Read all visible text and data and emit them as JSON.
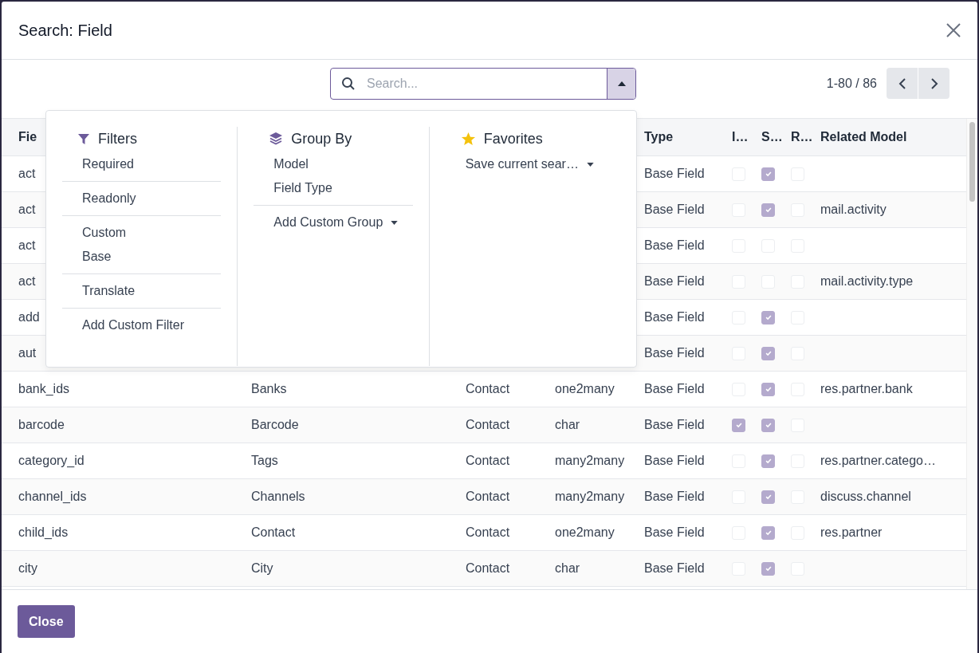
{
  "dialog": {
    "title": "Search: Field"
  },
  "search": {
    "placeholder": "Search...",
    "panel_open": true
  },
  "pager": {
    "range": "1-80 / 86"
  },
  "search_panel": {
    "filters": {
      "title": "Filters",
      "groups": [
        [
          {
            "label": "Required"
          }
        ],
        [
          {
            "label": "Readonly"
          }
        ],
        [
          {
            "label": "Custom"
          },
          {
            "label": "Base"
          }
        ],
        [
          {
            "label": "Translate"
          }
        ],
        [
          {
            "label": "Add Custom Filter"
          }
        ]
      ]
    },
    "group_by": {
      "title": "Group By",
      "groups": [
        [
          {
            "label": "Model"
          },
          {
            "label": "Field Type"
          }
        ],
        [
          {
            "label": "Add Custom Group",
            "has_caret": true
          }
        ]
      ]
    },
    "favorites": {
      "title": "Favorites",
      "groups": [
        [
          {
            "label": "Save current sear…",
            "has_caret": true
          }
        ]
      ]
    }
  },
  "table": {
    "columns": [
      {
        "label": "Fie"
      },
      {},
      {},
      {},
      {
        "label": "Type"
      },
      {
        "label": "I…"
      },
      {
        "label": "S…"
      },
      {
        "label": "R…"
      },
      {
        "label": "Related Model"
      }
    ],
    "rows": [
      {
        "field": "act",
        "type": "Base Field",
        "col_i": false,
        "col_s": true,
        "col_r": false
      },
      {
        "field": "act",
        "type": "Base Field",
        "col_i": false,
        "col_s": true,
        "col_r": false,
        "related": "mail.activity"
      },
      {
        "field": "act",
        "type": "Base Field",
        "col_i": false,
        "col_s": false,
        "col_r": false
      },
      {
        "field": "act",
        "type": "Base Field",
        "col_i": false,
        "col_s": false,
        "col_r": false,
        "related": "mail.activity.type"
      },
      {
        "field": "add",
        "type": "Base Field",
        "col_i": false,
        "col_s": true,
        "col_r": false
      },
      {
        "field": "aut",
        "type": "Base Field",
        "col_i": false,
        "col_s": true,
        "col_r": false
      },
      {
        "field": "bank_ids",
        "label": "Banks",
        "model": "Contact",
        "ftype": "one2many",
        "type": "Base Field",
        "col_i": false,
        "col_s": true,
        "col_r": false,
        "related": "res.partner.bank"
      },
      {
        "field": "barcode",
        "label": "Barcode",
        "model": "Contact",
        "ftype": "char",
        "type": "Base Field",
        "col_i": true,
        "col_s": true,
        "col_r": false
      },
      {
        "field": "category_id",
        "label": "Tags",
        "model": "Contact",
        "ftype": "many2many",
        "type": "Base Field",
        "col_i": false,
        "col_s": true,
        "col_r": false,
        "related": "res.partner.catego…"
      },
      {
        "field": "channel_ids",
        "label": "Channels",
        "model": "Contact",
        "ftype": "many2many",
        "type": "Base Field",
        "col_i": false,
        "col_s": true,
        "col_r": false,
        "related": "discuss.channel"
      },
      {
        "field": "child_ids",
        "label": "Contact",
        "model": "Contact",
        "ftype": "one2many",
        "type": "Base Field",
        "col_i": false,
        "col_s": true,
        "col_r": false,
        "related": "res.partner"
      },
      {
        "field": "city",
        "label": "City",
        "model": "Contact",
        "ftype": "char",
        "type": "Base Field",
        "col_i": false,
        "col_s": true,
        "col_r": false
      }
    ]
  },
  "footer": {
    "buttons": [
      "Close"
    ]
  }
}
